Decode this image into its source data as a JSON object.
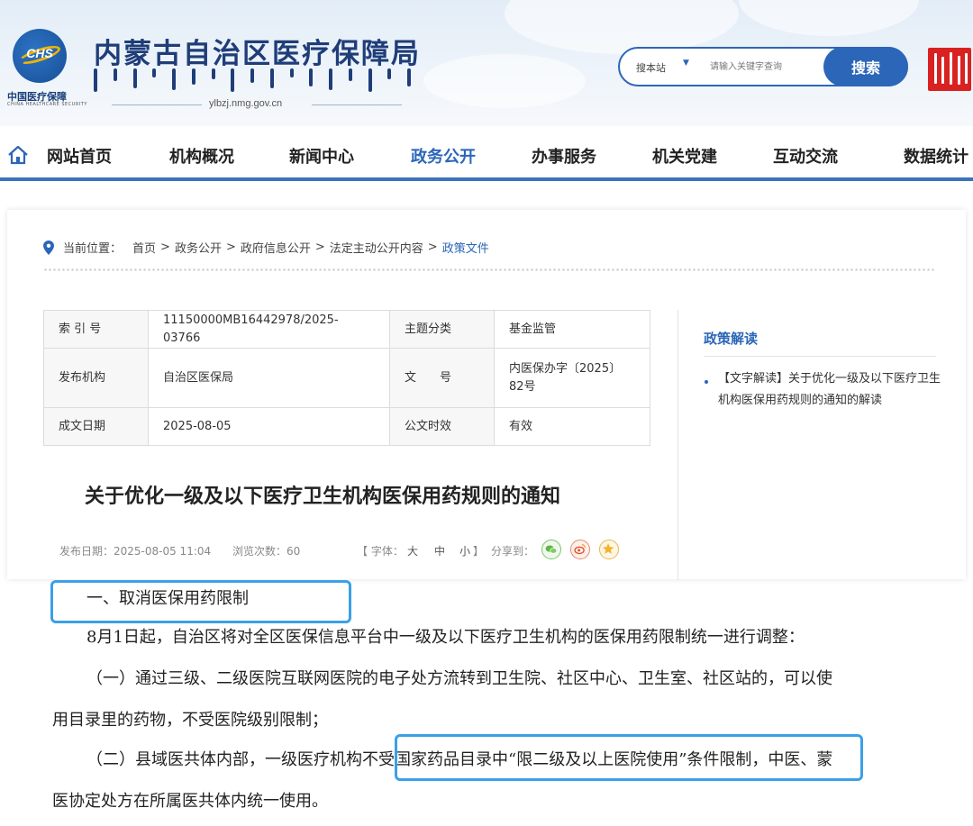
{
  "header": {
    "logo_abbr": "CHS",
    "logo_cn": "中国医疗保障",
    "logo_en": "CHINA HEALTHCARE SECURITY",
    "site_title": "内蒙古自治区医疗保障局",
    "domain": "ylbzj.nmg.gov.cn",
    "search_scope": "搜本站",
    "search_placeholder": "请输入关键字查询",
    "search_button": "搜索"
  },
  "nav": {
    "items": [
      {
        "label": "网站首页"
      },
      {
        "label": "机构概况"
      },
      {
        "label": "新闻中心"
      },
      {
        "label": "政务公开"
      },
      {
        "label": "办事服务"
      },
      {
        "label": "机关党建"
      },
      {
        "label": "互动交流"
      },
      {
        "label": "数据统计"
      }
    ],
    "active_color": "#2b66b8"
  },
  "breadcrumb": {
    "label": "当前位置：",
    "items": [
      "首页",
      "政务公开",
      "政府信息公开",
      "法定主动公开内容",
      "政策文件"
    ]
  },
  "meta_table": {
    "index_label": "索 引 号",
    "index_value": "11150000MB16442978/2025-03766",
    "topic_label": "主题分类",
    "topic_value": "基金监管",
    "publisher_label": "发布机构",
    "publisher_value": "自治区医保局",
    "docno_label": "文　　号",
    "docno_value": "内医保办字〔2025〕82号",
    "date_label": "成文日期",
    "date_value": "2025-08-05",
    "validity_label": "公文时效",
    "validity_value": "有效"
  },
  "sidebar": {
    "title": "政策解读",
    "link": "【文字解读】关于优化一级及以下医疗卫生机构医保用药规则的通知的解读"
  },
  "article": {
    "title": "关于优化一级及以下医疗卫生机构医保用药规则的通知",
    "publish_label": "发布日期：2025-08-05 11:04",
    "views_label": "浏览次数：60",
    "font_label": "【 字体：",
    "font_large": "大",
    "font_medium": "中",
    "font_small": "小",
    "font_close": "】",
    "share_label": "分享到："
  },
  "body": {
    "heading1": "一、取消医保用药限制",
    "p1": "8月1日起，自治区将对全区医保信息平台中一级及以下医疗卫生机构的医保用药限制统一进行调整：",
    "p2a": "（一）通过三级、二级医院互联网医院的电子处方流转到卫生院、社区中心、卫生室、社区站的，可以使",
    "p2b": "用目录里的药物，不受医院级别限制；",
    "p3a": "（二）县域医共体内部，一级医疗机构不受国家药品目录中“限二级及以上医院使用”条件限制，中医、蒙",
    "p3b": "医协定处方在所属医共体内统一使用。"
  },
  "colors": {
    "brand": "#2b66b8",
    "highlight": "#3aa0e8",
    "seal": "#d92121"
  }
}
